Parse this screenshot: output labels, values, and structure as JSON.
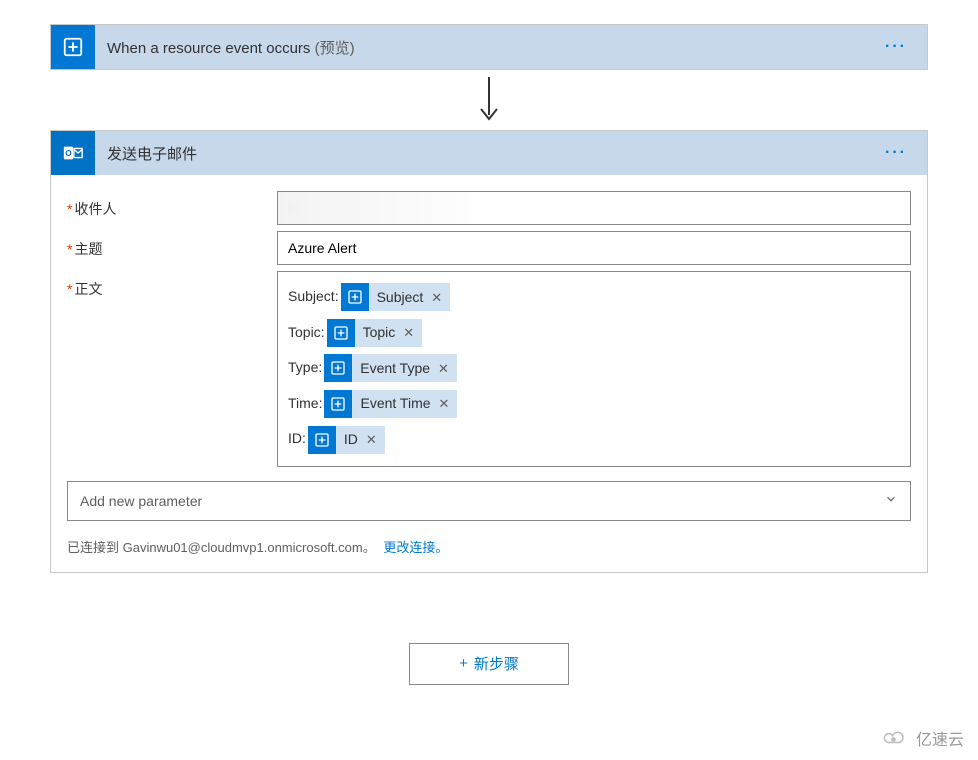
{
  "trigger": {
    "title": "When a resource event occurs",
    "suffix": "(预览)"
  },
  "action": {
    "title": "发送电子邮件",
    "fields": {
      "recipients_label": "收件人",
      "recipients_value": "i",
      "subject_label": "主题",
      "subject_value": "Azure Alert",
      "body_label": "正文"
    },
    "body_lines": [
      {
        "label": "Subject:",
        "token": "Subject"
      },
      {
        "label": "Topic:",
        "token": "Topic"
      },
      {
        "label": "Type:",
        "token": "Event Type"
      },
      {
        "label": "Time:",
        "token": "Event Time"
      },
      {
        "label": "ID:",
        "token": "ID"
      }
    ],
    "add_param": "Add new parameter",
    "connected_prefix": "已连接到 ",
    "connected_account": "Gavinwu01@cloudmvp1.onmicrosoft.com",
    "connected_suffix": "。",
    "change_link": "更改连接。"
  },
  "new_step": "新步骤",
  "watermark": "亿速云"
}
